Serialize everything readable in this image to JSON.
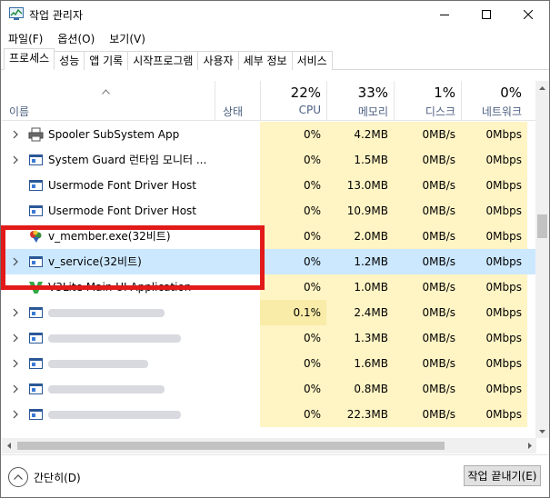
{
  "window": {
    "title": "작업 관리자"
  },
  "menu": [
    "파일(F)",
    "옵션(O)",
    "보기(V)"
  ],
  "tabs": [
    "프로세스",
    "성능",
    "앱 기록",
    "시작프로그램",
    "사용자",
    "세부 정보",
    "서비스"
  ],
  "active_tab": "프로세스",
  "columns": {
    "name": {
      "label": "이름"
    },
    "status": {
      "label": "상태"
    },
    "cpu": {
      "pct": "22%",
      "label": "CPU"
    },
    "memory": {
      "pct": "33%",
      "label": "메모리"
    },
    "disk": {
      "pct": "1%",
      "label": "디스크"
    },
    "network": {
      "pct": "0%",
      "label": "네트워크"
    }
  },
  "rows": [
    {
      "name": "Spooler SubSystem App",
      "cpu": "0%",
      "mem": "4.2MB",
      "disk": "0MB/s",
      "net": "0Mbps",
      "icon": "printer-icon",
      "expander": true
    },
    {
      "name": "System Guard 런타임 모니터 ...",
      "cpu": "0%",
      "mem": "1.5MB",
      "disk": "0MB/s",
      "net": "0Mbps",
      "icon": "window-icon",
      "expander": true
    },
    {
      "name": "Usermode Font Driver Host",
      "cpu": "0%",
      "mem": "13.0MB",
      "disk": "0MB/s",
      "net": "0Mbps",
      "icon": "window-icon",
      "expander": false
    },
    {
      "name": "Usermode Font Driver Host",
      "cpu": "0%",
      "mem": "10.9MB",
      "disk": "0MB/s",
      "net": "0Mbps",
      "icon": "window-icon",
      "expander": false
    },
    {
      "name": "v_member.exe(32비트)",
      "cpu": "0%",
      "mem": "2.0MB",
      "disk": "0MB/s",
      "net": "0Mbps",
      "icon": "v-member-icon",
      "expander": false
    },
    {
      "name": "v_service(32비트)",
      "cpu": "0%",
      "mem": "1.2MB",
      "disk": "0MB/s",
      "net": "0Mbps",
      "icon": "window-icon",
      "expander": true,
      "selected": true
    },
    {
      "name": "V3Lite Main UI Application",
      "cpu": "0%",
      "mem": "1.0MB",
      "disk": "0MB/s",
      "net": "0Mbps",
      "icon": "v3-icon",
      "expander": false
    },
    {
      "name": "",
      "cpu": "0.1%",
      "mem": "2.4MB",
      "disk": "0MB/s",
      "net": "0Mbps",
      "icon": "window-icon",
      "expander": true,
      "blurred": true,
      "hot": true
    },
    {
      "name": "",
      "cpu": "0%",
      "mem": "1.3MB",
      "disk": "0MB/s",
      "net": "0Mbps",
      "icon": "window-icon",
      "expander": true,
      "blurred": true
    },
    {
      "name": "",
      "cpu": "0%",
      "mem": "1.6MB",
      "disk": "0MB/s",
      "net": "0Mbps",
      "icon": "window-icon",
      "expander": true,
      "blurred": true
    },
    {
      "name": "",
      "cpu": "0%",
      "mem": "0.8MB",
      "disk": "0MB/s",
      "net": "0Mbps",
      "icon": "window-icon",
      "expander": true,
      "blurred": true
    },
    {
      "name": "",
      "cpu": "0%",
      "mem": "22.3MB",
      "disk": "0MB/s",
      "net": "0Mbps",
      "icon": "window-icon",
      "expander": true,
      "blurred": true
    }
  ],
  "footer": {
    "collapse_label": "간단히(D)",
    "end_task_label": "작업 끝내기(E)"
  },
  "colors": {
    "cpu_tint": "#fff4c4",
    "selected": "#cce8ff",
    "highlight_box": "#e21a1a"
  }
}
